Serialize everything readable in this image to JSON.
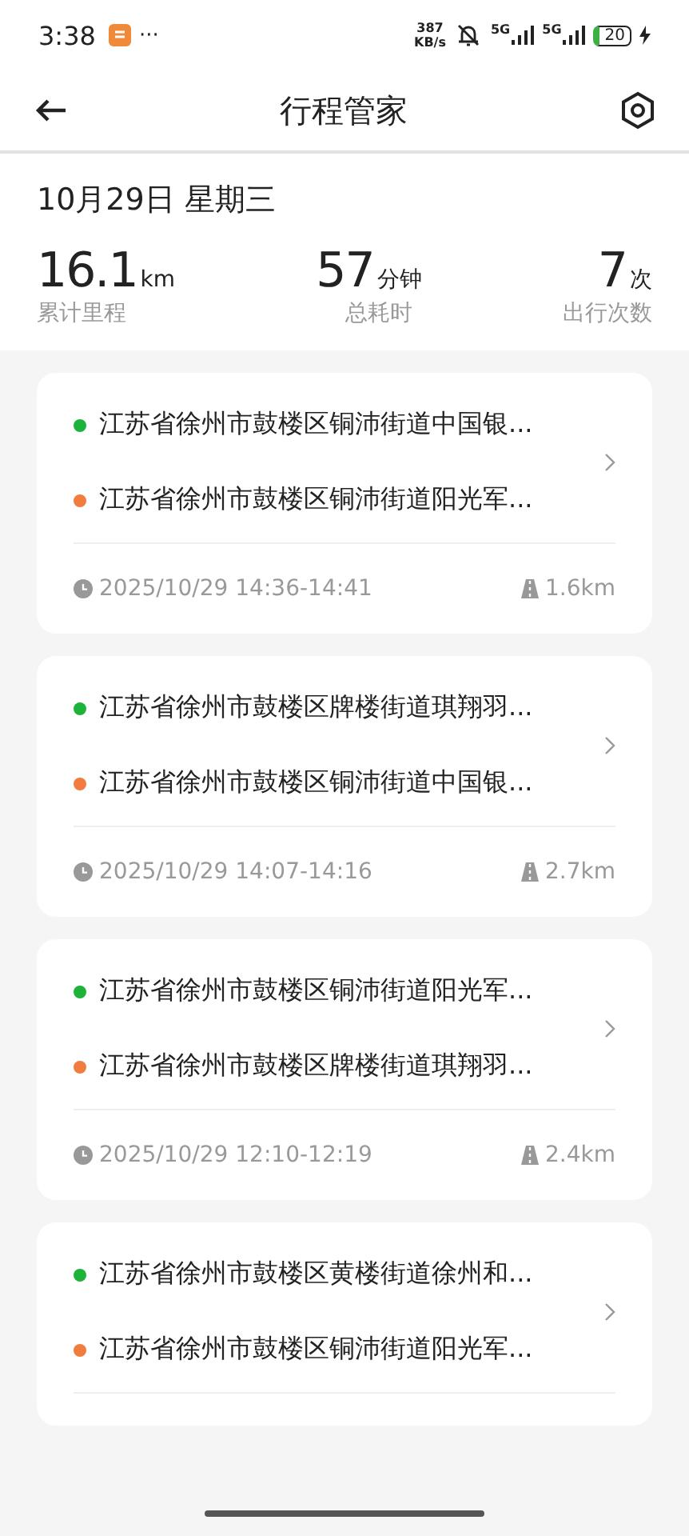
{
  "status_bar": {
    "time": "3:38",
    "more": "···",
    "speed": "387",
    "speed_unit": "KB/s",
    "network_1": "5G",
    "network_2": "5G",
    "battery": "20"
  },
  "header": {
    "title": "行程管家"
  },
  "summary": {
    "date": "10月29日 星期三",
    "stats": [
      {
        "value": "16.1",
        "unit": "km",
        "label": "累计里程"
      },
      {
        "value": "57",
        "unit": "分钟",
        "label": "总耗时"
      },
      {
        "value": "7",
        "unit": "次",
        "label": "出行次数"
      }
    ]
  },
  "trips": [
    {
      "points": [
        {
          "kind": "start",
          "address": "江苏省徐州市鼓楼区铜沛街道中国银..."
        },
        {
          "kind": "end",
          "address": "江苏省徐州市鼓楼区铜沛街道阳光军..."
        }
      ],
      "time": "2025/10/29 14:36-14:41",
      "distance": "1.6km"
    },
    {
      "points": [
        {
          "kind": "start",
          "address": "江苏省徐州市鼓楼区牌楼街道琪翔羽..."
        },
        {
          "kind": "end",
          "address": "江苏省徐州市鼓楼区铜沛街道中国银..."
        }
      ],
      "time": "2025/10/29 14:07-14:16",
      "distance": "2.7km"
    },
    {
      "points": [
        {
          "kind": "start",
          "address": "江苏省徐州市鼓楼区铜沛街道阳光军..."
        },
        {
          "kind": "end",
          "address": "江苏省徐州市鼓楼区牌楼街道琪翔羽..."
        }
      ],
      "time": "2025/10/29 12:10-12:19",
      "distance": "2.4km"
    },
    {
      "points": [
        {
          "kind": "start",
          "address": "江苏省徐州市鼓楼区黄楼街道徐州和..."
        },
        {
          "kind": "end",
          "address": "江苏省徐州市鼓楼区铜沛街道阳光军..."
        }
      ]
    }
  ]
}
